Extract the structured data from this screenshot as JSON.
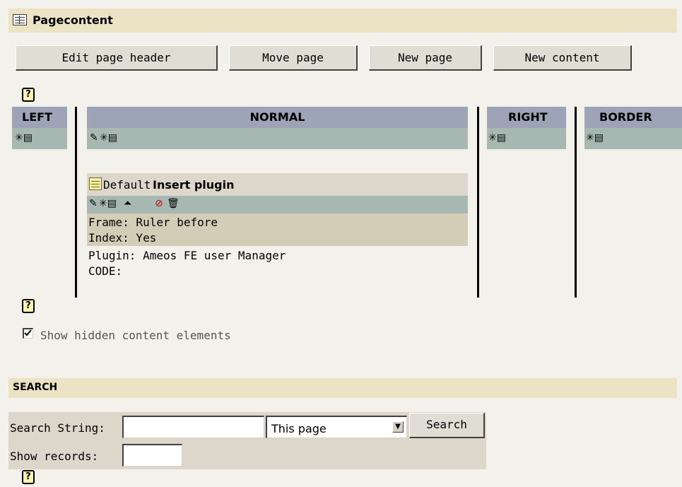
{
  "pagecontent": {
    "title": "Pagecontent",
    "icon": "table-icon"
  },
  "toolbar": {
    "edit_page_header": "Edit page header",
    "move_page": "Move page",
    "new_page": "New page",
    "new_content": "New content"
  },
  "help": {
    "glyph": "?"
  },
  "columns": {
    "left": "LEFT",
    "normal": "NORMAL",
    "right": "RIGHT",
    "border": "BORDER"
  },
  "content_element": {
    "type": "Default",
    "title": "Insert plugin",
    "frame": "Frame: Ruler before",
    "index": "Index: Yes",
    "plugin": "Plugin: Ameos FE user Manager",
    "code": "CODE:"
  },
  "show_hidden": {
    "label": "Show hidden content elements",
    "checked": true
  },
  "search": {
    "title": "SEARCH",
    "string_label": "Search String:",
    "string_value": "",
    "scope_selected": "This page",
    "button_label": "Search",
    "show_records_label": "Show records:",
    "show_records_value": ""
  },
  "colors": {
    "section_header": "#ebe3c4",
    "column_header": "#9ea4b8",
    "toolbar_row": "#a7b8b2",
    "background": "#f3f1ec"
  }
}
